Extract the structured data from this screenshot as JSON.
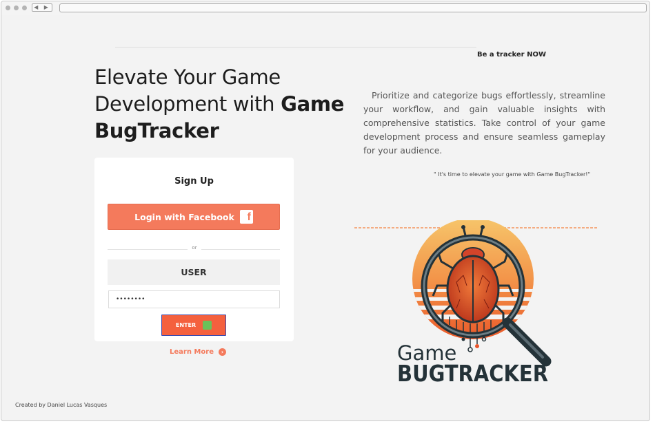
{
  "browser": {
    "nav_arrows": "◀ ▶"
  },
  "header": {
    "cta": "Be a tracker NOW"
  },
  "hero": {
    "headline_part1": "Elevate Your Game Development with ",
    "headline_bold": "Game BugTracker",
    "description": "Prioritize and categorize bugs effortlessly, streamline your workflow, and gain valuable insights with comprehensive statistics. Take control of your game development process and ensure seamless gameplay for your audience.",
    "quote": "\" It's time to elevate your game with Game BugTracker!\""
  },
  "signup": {
    "title": "Sign Up",
    "facebook_label": "Login with Facebook",
    "facebook_icon": "f",
    "or_label": "or",
    "user_label": "USER",
    "password_value": "••••••••",
    "enter_label": "ENTER",
    "learn_more": "Learn More",
    "learn_more_icon": "›"
  },
  "logo": {
    "line1": "Game",
    "line2": "BUGTRACKER"
  },
  "footer": {
    "credit": "Created by Daniel Lucas Vasques"
  },
  "colors": {
    "accent": "#f47a5c",
    "enter": "#f4603e",
    "enter_border": "#3a4bb0",
    "enter_indicator": "#6ac259",
    "logo_text": "#243238"
  }
}
